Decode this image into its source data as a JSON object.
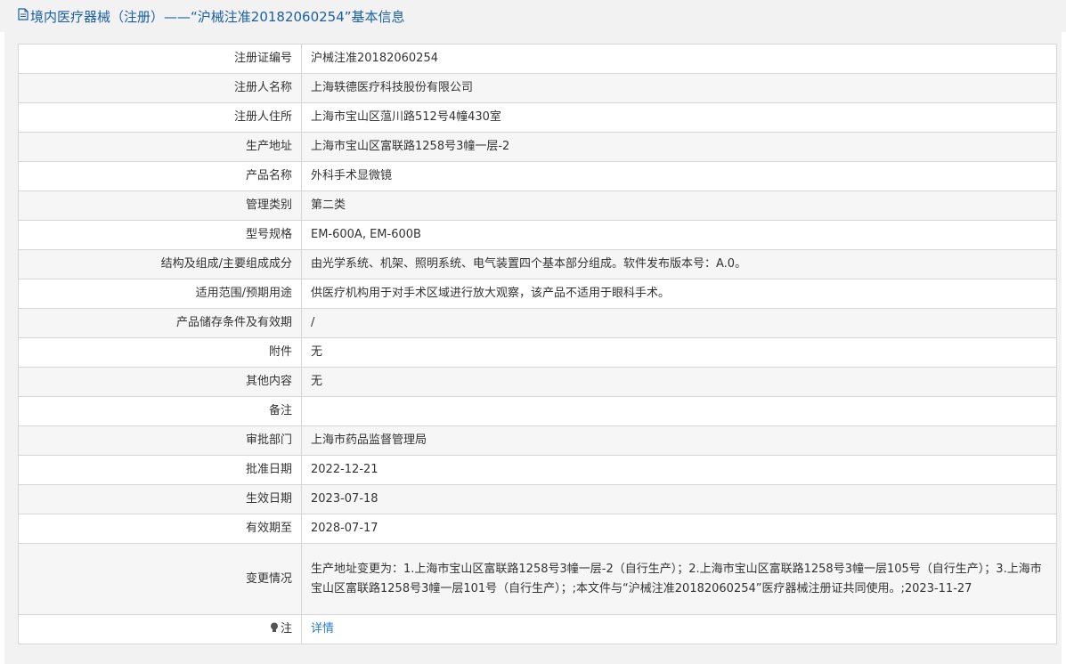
{
  "header": {
    "title": "境内医疗器械（注册）——“沪械注准20182060254”基本信息"
  },
  "rows": [
    {
      "label": "注册证编号",
      "value": "沪械注准20182060254"
    },
    {
      "label": "注册人名称",
      "value": "上海轶德医疗科技股份有限公司"
    },
    {
      "label": "注册人住所",
      "value": "上海市宝山区蕰川路512号4幢430室"
    },
    {
      "label": "生产地址",
      "value": "上海市宝山区富联路1258号3幢一层-2"
    },
    {
      "label": "产品名称",
      "value": "外科手术显微镜"
    },
    {
      "label": "管理类别",
      "value": "第二类"
    },
    {
      "label": "型号规格",
      "value": "EM-600A, EM-600B"
    },
    {
      "label": "结构及组成/主要组成成分",
      "value": "由光学系统、机架、照明系统、电气装置四个基本部分组成。软件发布版本号：A.0。"
    },
    {
      "label": "适用范围/预期用途",
      "value": "供医疗机构用于对手术区域进行放大观察，该产品不适用于眼科手术。"
    },
    {
      "label": "产品储存条件及有效期",
      "value": "/"
    },
    {
      "label": "附件",
      "value": "无"
    },
    {
      "label": "其他内容",
      "value": "无"
    },
    {
      "label": "备注",
      "value": ""
    },
    {
      "label": "审批部门",
      "value": "上海市药品监督管理局"
    },
    {
      "label": "批准日期",
      "value": "2022-12-21"
    },
    {
      "label": "生效日期",
      "value": "2023-07-18"
    },
    {
      "label": "有效期至",
      "value": "2028-07-17"
    },
    {
      "label": "变更情况",
      "value": "生产地址变更为：1.上海市宝山区富联路1258号3幢一层-2（自行生产）；2.上海市宝山区富联路1258号3幢一层105号（自行生产）；3.上海市宝山区富联路1258号3幢一层101号（自行生产）；;本文件与“沪械注准20182060254”医疗器械注册证共同使用。;2023-11-27"
    }
  ],
  "note": {
    "label": "注",
    "link_text": "详情",
    "icon": "bulb-icon"
  },
  "colors": {
    "title": "#1a5fa6",
    "link": "#2a7bc9",
    "border": "#d6d6d6",
    "stripe": "#f6f6f6"
  }
}
